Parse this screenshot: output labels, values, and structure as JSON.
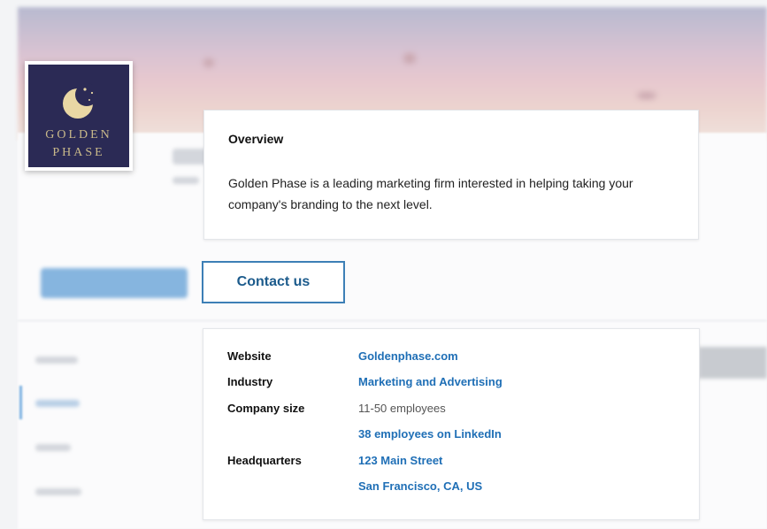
{
  "logo": {
    "line1": "GOLDEN",
    "line2": "PHASE",
    "bg_color": "#2b2a55",
    "text_color": "#c9b98a"
  },
  "overview": {
    "title": "Overview",
    "description": "Golden Phase is a leading marketing firm interested in helping taking your company's branding to the next level."
  },
  "contact_button": {
    "label": "Contact us"
  },
  "details": {
    "website_label": "Website",
    "website_value": "Goldenphase.com",
    "industry_label": "Industry",
    "industry_value": "Marketing and Advertising",
    "company_size_label": "Company size",
    "company_size_value": "11-50 employees",
    "employees_link": "38 employees on LinkedIn",
    "headquarters_label": "Headquarters",
    "headquarters_street": "123 Main Street",
    "headquarters_city": "San Francisco, CA, US"
  },
  "colors": {
    "link": "#1f6fb6",
    "button_border": "#3d7fb6"
  }
}
